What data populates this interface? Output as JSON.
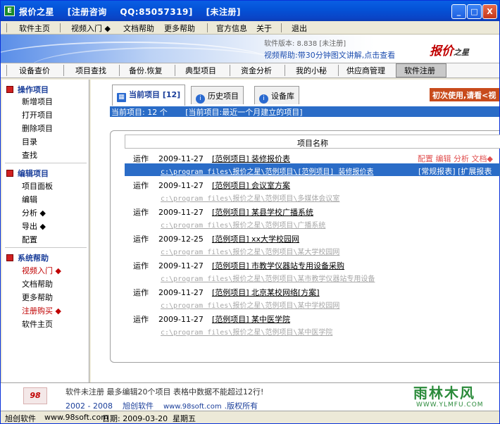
{
  "titlebar": {
    "app_icon": "E",
    "title": "报价之星",
    "register_consult": "[注册咨询",
    "qq": "QQ:85057319]",
    "unregistered": "[未注册]",
    "min_label": "_",
    "max_label": "□",
    "close_label": "X"
  },
  "menu": [
    "软件主页",
    "视频入门 ◆",
    "文档帮助",
    "更多帮助",
    "官方信息",
    "关于",
    "退出"
  ],
  "banner": {
    "version": "软件版本: 8.838  [未注册]",
    "video_help": "视频帮助:带30分钟图文讲解,点击查看",
    "logo": "报价",
    "logo_suffix": "之星"
  },
  "toolbar": [
    "设备查价",
    "项目查找",
    "备份.恢复",
    "典型项目",
    "资金分析",
    "我的小秘",
    "供应商管理",
    "软件注册"
  ],
  "sidebar": {
    "sections": [
      {
        "title": "操作项目",
        "items": [
          "新增项目",
          "打开项目",
          "删除项目",
          "目录",
          "查找"
        ]
      },
      {
        "title": "编辑项目",
        "items": [
          "项目面板",
          "编辑",
          "分析 ◆",
          "导出 ◆",
          "配置"
        ]
      },
      {
        "title": "系统帮助",
        "items": [
          "视频入门 ◆",
          "文档帮助",
          "更多帮助",
          "注册购买 ◆",
          "软件主页"
        ]
      }
    ]
  },
  "tabs": [
    {
      "label": "当前项目 [12]",
      "icon": "table-icon"
    },
    {
      "label": "历史项目",
      "icon": "info-icon"
    },
    {
      "label": "设备库",
      "icon": "info-icon"
    }
  ],
  "hint_button": "初次使用,请看<视",
  "current_bar": {
    "count": "当前项目: 12 个",
    "desc": "[当前项目:最近一个月建立的项目]"
  },
  "table": {
    "column": "项目名称",
    "selected_actions": "配置 编辑 分析 文档◆",
    "selected_reports": "[常规报表] [扩展报表",
    "rows": [
      {
        "status": "运作",
        "date": "2009-11-27",
        "name": "[范例项目] 装修报价表",
        "path": "c:\\program files\\报价之星\\范例项目\\[范例项目] 装修报价表"
      },
      {
        "status": "运作",
        "date": "2009-11-27",
        "name": "[范例项目] 会议室方案",
        "path": "c:\\program files\\报价之星\\范例项目\\多媒体会议室"
      },
      {
        "status": "运作",
        "date": "2009-11-27",
        "name": "[范例项目] 某县学校广播系统",
        "path": "c:\\program files\\报价之星\\范例项目\\广播系统"
      },
      {
        "status": "运作",
        "date": "2009-12-25",
        "name": "[范例项目] xx大学校园网",
        "path": "c:\\program files\\报价之星\\范例项目\\某大学校园网"
      },
      {
        "status": "运作",
        "date": "2009-11-27",
        "name": "[范例项目] 市教学仪器站专用设备采购",
        "path": "c:\\program files\\报价之星\\范例项目\\某市教学仪器站专用设备"
      },
      {
        "status": "运作",
        "date": "2009-11-27",
        "name": "[范例项目] 北京某校网络[方案]",
        "path": "c:\\program files\\报价之星\\范例项目\\某中学校园网"
      },
      {
        "status": "运作",
        "date": "2009-11-27",
        "name": "[范例项目] 某中医学院",
        "path": "c:\\program files\\报价之星\\范例项目\\某中医学院"
      }
    ]
  },
  "footer": {
    "logo": "98",
    "notice": "软件未注册 最多编辑20个项目 表格中数据不能超过12行!",
    "years": "2002 - 2008",
    "company": "旭创软件",
    "url": "www.98soft.com",
    "rights": ".版权所有"
  },
  "watermark": {
    "text": "雨林木风",
    "url": "WWW.YLMFU.COM"
  },
  "statusbar": {
    "company": "旭创软件",
    "url": "www.98soft.com",
    "date": "日期: 2009-03-20",
    "weekday": "星期五"
  }
}
